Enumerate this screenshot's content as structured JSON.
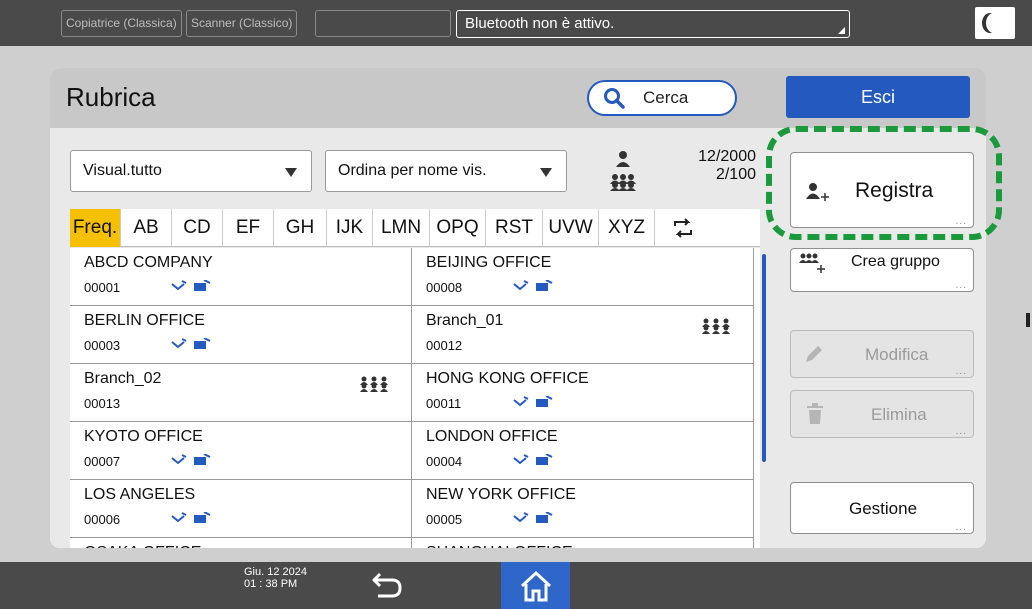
{
  "topbar": {
    "tabs": [
      "Copiatrice (Classica)",
      "Scanner (Classico)",
      ""
    ],
    "message": "Bluetooth non è attivo."
  },
  "header": {
    "title": "Rubrica",
    "search_label": "Cerca",
    "exit_label": "Esci"
  },
  "filters": {
    "view": "Visual.tutto",
    "sort": "Ordina per nome vis."
  },
  "counts": {
    "users": "12/2000",
    "groups": "2/100"
  },
  "tabs": [
    "Freq.",
    "AB",
    "CD",
    "EF",
    "GH",
    "IJK",
    "LMN",
    "OPQ",
    "RST",
    "UVW",
    "XYZ"
  ],
  "entries": [
    {
      "name": "ABCD COMPANY",
      "number": "00001",
      "type": "dest"
    },
    {
      "name": "BEIJING OFFICE",
      "number": "00008",
      "type": "dest"
    },
    {
      "name": "BERLIN OFFICE",
      "number": "00003",
      "type": "dest"
    },
    {
      "name": "Branch_01",
      "number": "00012",
      "type": "group"
    },
    {
      "name": "Branch_02",
      "number": "00013",
      "type": "group"
    },
    {
      "name": "HONG KONG OFFICE",
      "number": "00011",
      "type": "dest"
    },
    {
      "name": "KYOTO OFFICE",
      "number": "00007",
      "type": "dest"
    },
    {
      "name": "LONDON OFFICE",
      "number": "00004",
      "type": "dest"
    },
    {
      "name": "LOS ANGELES",
      "number": "00006",
      "type": "dest"
    },
    {
      "name": "NEW YORK OFFICE",
      "number": "00005",
      "type": "dest"
    },
    {
      "name": "OSAKA OFFICE",
      "number": "",
      "type": "partial"
    },
    {
      "name": "SHANGHAI OFFICE",
      "number": "",
      "type": "partial"
    }
  ],
  "side": {
    "register": "Registra",
    "create_group": "Crea gruppo",
    "edit": "Modifica",
    "delete": "Elimina",
    "manage": "Gestione"
  },
  "footer": {
    "date": "Giu. 12 2024",
    "time": "01 : 38 PM"
  },
  "colors": {
    "accent": "#2459c0",
    "active_tab": "#f5c000",
    "highlight": "#1a9a3a"
  }
}
